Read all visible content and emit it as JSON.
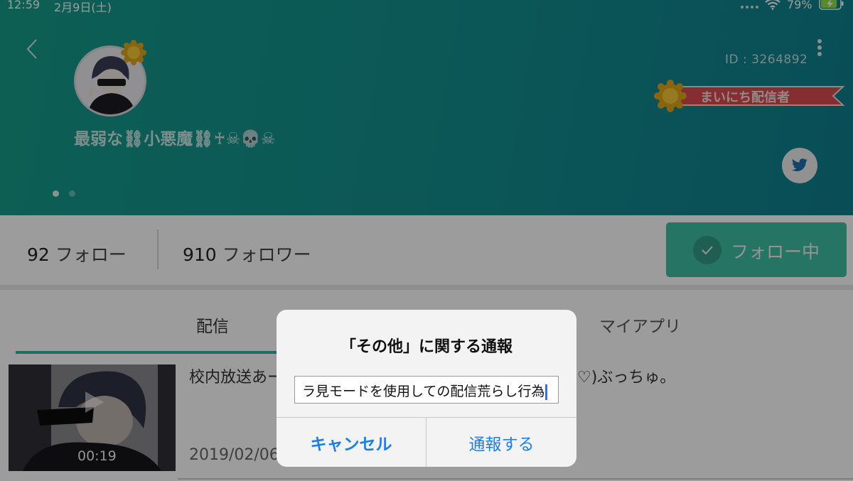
{
  "status_bar": {
    "time": "12:59",
    "date": "2月9日(土)",
    "battery": "79%"
  },
  "profile": {
    "user_id": "ID : 3264892",
    "username": "最弱な⛓小悪魔⛓♰☠💀☠",
    "badge": "まいにち配信者",
    "avatar_label": "avatar"
  },
  "stats": {
    "follow_count": "92",
    "follow_label": "フォロー",
    "follower_count": "910",
    "follower_label": "フォロワー",
    "follow_button": "フォロー中"
  },
  "tabs": [
    {
      "label": "配信",
      "active": true
    },
    {
      "label": "マイアプリ",
      "active": false
    }
  ],
  "stream_item": {
    "title_left": "校内放送あー",
    "title_right": "̈♡)ぶっちゅ。",
    "duration": "00:19",
    "date": "2019/02/06"
  },
  "dialog": {
    "title": "「その他」に関する通報",
    "input_value": "ラ見モードを使用しての配信荒らし行為",
    "cancel": "キャンセル",
    "report": "通報する"
  },
  "colors": {
    "header_teal": "#13908f",
    "follow_button": "#3fbfa4",
    "tab_underline": "#2db39e",
    "dialog_button": "#1a7ff0"
  }
}
